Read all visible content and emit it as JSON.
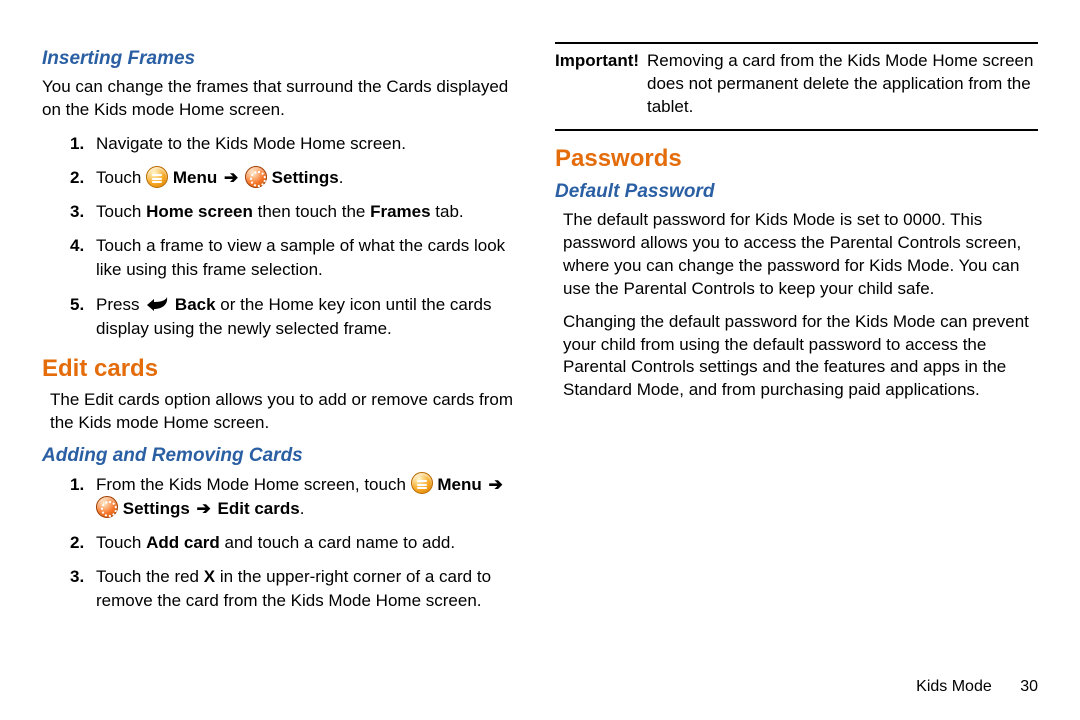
{
  "left": {
    "sub1": "Inserting Frames",
    "p1": "You can change the frames that surround the Cards displayed on the Kids mode Home screen.",
    "steps1": {
      "n1": "1.",
      "t1": "Navigate to the Kids Mode Home screen.",
      "n2": "2.",
      "t2a": "Touch ",
      "t2_menu": " Menu ",
      "t2_arrow": "➔",
      "t2_settings": " Settings",
      "t2_period": ".",
      "n3": "3.",
      "t3a": "Touch ",
      "t3b": "Home screen",
      "t3c": " then touch the ",
      "t3d": "Frames",
      "t3e": " tab.",
      "n4": "4.",
      "t4": "Touch a frame to view a sample of what the cards look like using this frame selection.",
      "n5": "5.",
      "t5a": "Press ",
      "t5_back": " Back",
      "t5b": " or the Home key icon until the cards display using the newly selected frame."
    },
    "h2a": "Edit cards",
    "p2": "The Edit cards option allows you to add or remove cards from the Kids mode Home screen.",
    "sub2": "Adding and Removing Cards",
    "steps2": {
      "n1": "1.",
      "t1a": "From the Kids Mode Home screen, touch ",
      "t1_menu": " Menu ",
      "t1_arrow1": "➔",
      "t1_settings": " Settings ",
      "t1_arrow2": "➔",
      "t1_edit": " Edit cards",
      "t1_period": ".",
      "n2": "2.",
      "t2a": "Touch ",
      "t2b": "Add card",
      "t2c": " and touch a card name to add.",
      "n3": "3.",
      "t3a": "Touch the red ",
      "t3x": "X",
      "t3b": " in the upper-right corner of a card to remove the card from the Kids Mode Home screen."
    }
  },
  "right": {
    "note_lead": "Important!",
    "note_body": "Removing a card from the Kids Mode Home screen does not permanent delete the application from the tablet.",
    "h2b": "Passwords",
    "sub3": "Default Password",
    "p3": "The default password for Kids Mode is set to 0000. This password allows you to access the Parental Controls screen, where you can change the password for Kids Mode. You can use the Parental Controls to keep your child safe.",
    "p4": "Changing the default password for the Kids Mode can prevent your child from using the default password to access the Parental Controls settings and the features and apps in the Standard Mode, and from purchasing paid applications."
  },
  "footer": {
    "section": "Kids Mode",
    "page": "30"
  }
}
